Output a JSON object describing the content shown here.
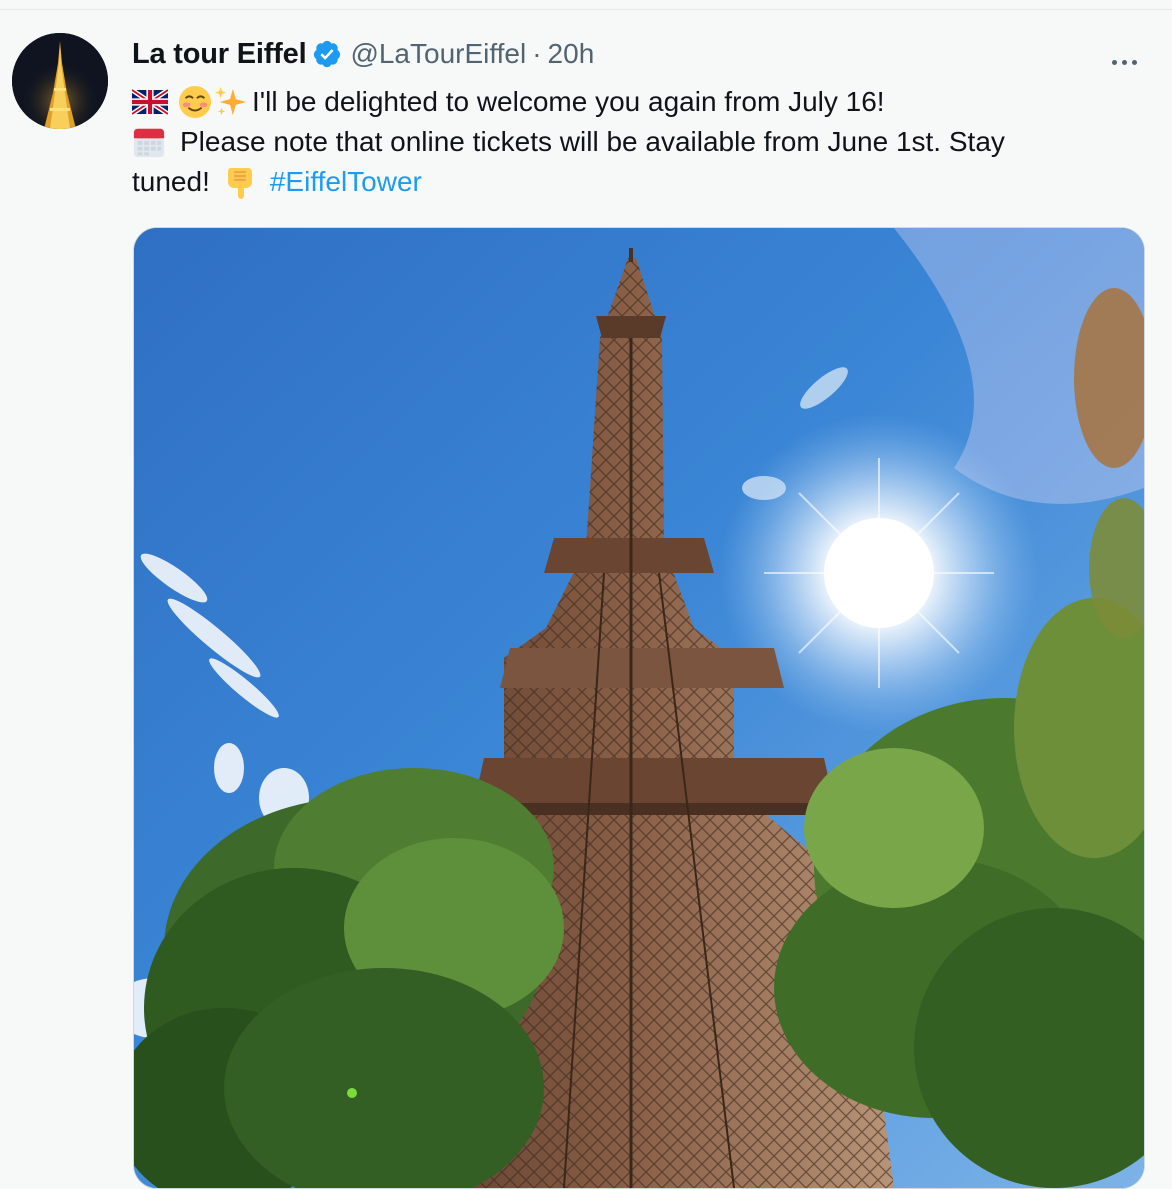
{
  "tweet": {
    "display_name": "La tour Eiffel",
    "handle": "@LaTourEiffel",
    "separator": "·",
    "time": "20h",
    "line1": "I'll be delighted to welcome you again from July 16!",
    "line2": "Please note that online tickets will be available from June 1st. Stay",
    "line3": "tuned!",
    "hashtag": "#EiffelTower",
    "emojis": [
      "uk-flag-icon",
      "smiling-face-icon",
      "sparkles-icon",
      "calendar-icon",
      "pointing-down-icon"
    ],
    "image_alt": "Eiffel Tower photographed from below against a blue sky with the sun and trees"
  },
  "colors": {
    "background": "#f7f9f9",
    "text": "#0f1419",
    "secondary": "#536471",
    "link": "#1d9bf0",
    "verified": "#1d9bf0"
  }
}
